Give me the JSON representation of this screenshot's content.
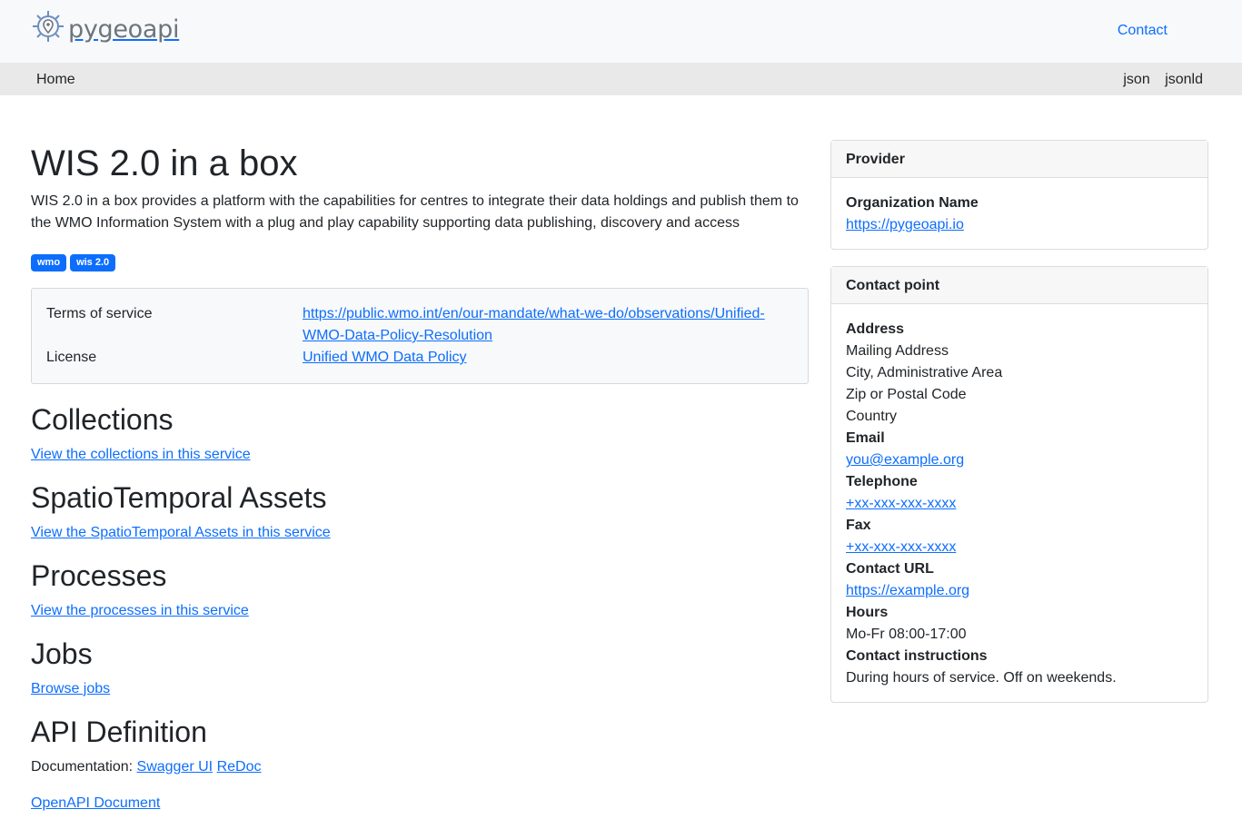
{
  "header": {
    "logo_text": "pygeoapi",
    "contact_label": "Contact"
  },
  "nav": {
    "home_label": "Home",
    "json_label": "json",
    "jsonld_label": "jsonld"
  },
  "main": {
    "title": "WIS 2.0 in a box",
    "description": "WIS 2.0 in a box provides a platform with the capabilities for centres to integrate their data holdings and publish them to the WMO Information System with a plug and play capability supporting data publishing, discovery and access",
    "keywords": [
      "wmo",
      "wis 2.0"
    ],
    "terms_label": "Terms of service",
    "terms_url": "https://public.wmo.int/en/our-mandate/what-we-do/observations/Unified-WMO-Data-Policy-Resolution",
    "terms_url_line1": "https://public.wmo.int/en/our-mandate/what-we-do/observations/Unified-",
    "terms_url_line2": "WMO-Data-Policy-Resolution",
    "license_label": "License",
    "license_value": "Unified WMO Data Policy",
    "collections_heading": "Collections",
    "collections_link": "View the collections in this service",
    "stac_heading": "SpatioTemporal Assets",
    "stac_link": "View the SpatioTemporal Assets in this service",
    "processes_heading": "Processes",
    "processes_link": "View the processes in this service",
    "jobs_heading": "Jobs",
    "jobs_link": "Browse jobs",
    "api_heading": "API Definition",
    "documentation_label": "Documentation:",
    "swagger_link": "Swagger UI",
    "redoc_link": "ReDoc",
    "openapi_link": "OpenAPI Document"
  },
  "provider": {
    "heading": "Provider",
    "org_label": "Organization Name",
    "org_url": "https://pygeoapi.io"
  },
  "contact": {
    "heading": "Contact point",
    "address_label": "Address",
    "address_line1": "Mailing Address",
    "address_line2": "City, Administrative Area",
    "address_line3": "Zip or Postal Code",
    "address_line4": "Country",
    "email_label": "Email",
    "email_value": "you@example.org",
    "telephone_label": "Telephone",
    "telephone_value": "+xx-xxx-xxx-xxxx",
    "fax_label": "Fax",
    "fax_value": "+xx-xxx-xxx-xxxx",
    "url_label": "Contact URL",
    "url_value": "https://example.org",
    "hours_label": "Hours",
    "hours_value": "Mo-Fr 08:00-17:00",
    "instructions_label": "Contact instructions",
    "instructions_value": "During hours of service. Off on weekends."
  }
}
